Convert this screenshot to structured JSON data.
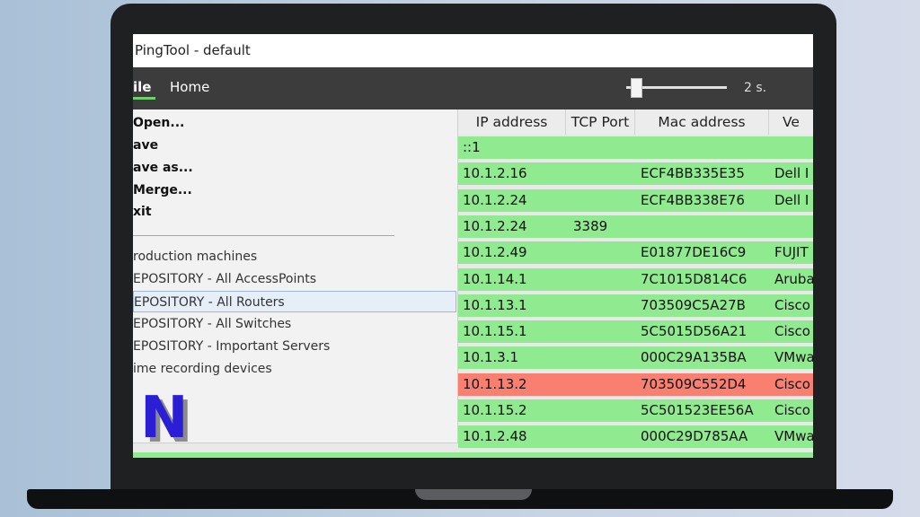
{
  "window": {
    "title": "PingTool - default"
  },
  "ribbon": {
    "tabs": [
      {
        "label": "ile"
      },
      {
        "label": "Home"
      }
    ],
    "interval_label": "2 s.",
    "interval_slider": {
      "value_fraction": 0.1
    }
  },
  "file_menu": {
    "items": [
      {
        "label": "Open..."
      },
      {
        "label": "ave"
      },
      {
        "label": "ave as..."
      },
      {
        "label": "Merge..."
      },
      {
        "label": "xit"
      }
    ],
    "recent": [
      {
        "label": "roduction machines"
      },
      {
        "label": "EPOSITORY - All AccessPoints"
      },
      {
        "label": "EPOSITORY - All Routers",
        "selected": true
      },
      {
        "label": "EPOSITORY - All Switches"
      },
      {
        "label": "EPOSITORY - Important Servers"
      },
      {
        "label": "ime recording devices"
      }
    ],
    "logo_letter": "N",
    "logo_colors": {
      "fill": "#2b1fd6",
      "shadow": "#8b8b8b"
    }
  },
  "table": {
    "columns": [
      {
        "label": "IP address"
      },
      {
        "label": "TCP Port"
      },
      {
        "label": "Mac address"
      },
      {
        "label": "Ve"
      }
    ],
    "rows": [
      {
        "ip": "::1",
        "port": "",
        "mac": "",
        "vendor": "",
        "status": "up"
      },
      {
        "ip": "10.1.2.16",
        "port": "",
        "mac": "ECF4BB335E35",
        "vendor": "Dell I",
        "status": "up"
      },
      {
        "ip": "10.1.2.24",
        "port": "",
        "mac": "ECF4BB338E76",
        "vendor": "Dell I",
        "status": "up"
      },
      {
        "ip": "10.1.2.24",
        "port": "3389",
        "mac": "",
        "vendor": "",
        "status": "up"
      },
      {
        "ip": "10.1.2.49",
        "port": "",
        "mac": "E01877DE16C9",
        "vendor": "FUJIT",
        "status": "up"
      },
      {
        "ip": "10.1.14.1",
        "port": "",
        "mac": "7C1015D814C6",
        "vendor": "Aruba",
        "status": "up"
      },
      {
        "ip": "10.1.13.1",
        "port": "",
        "mac": "703509C5A27B",
        "vendor": "Cisco",
        "status": "up"
      },
      {
        "ip": "10.1.15.1",
        "port": "",
        "mac": "5C5015D56A21",
        "vendor": "Cisco",
        "status": "up"
      },
      {
        "ip": "10.1.3.1",
        "port": "",
        "mac": "000C29A135BA",
        "vendor": "VMwa",
        "status": "up"
      },
      {
        "ip": "10.1.13.2",
        "port": "",
        "mac": "703509C552D4",
        "vendor": "Cisco",
        "status": "down"
      },
      {
        "ip": "10.1.15.2",
        "port": "",
        "mac": "5C501523EE56A",
        "vendor": "Cisco",
        "status": "up"
      },
      {
        "ip": "10.1.2.48",
        "port": "",
        "mac": "000C29D785AA",
        "vendor": "VMwa",
        "status": "up"
      }
    ],
    "colors": {
      "up": "#90ea8f",
      "down": "#f98071"
    }
  }
}
